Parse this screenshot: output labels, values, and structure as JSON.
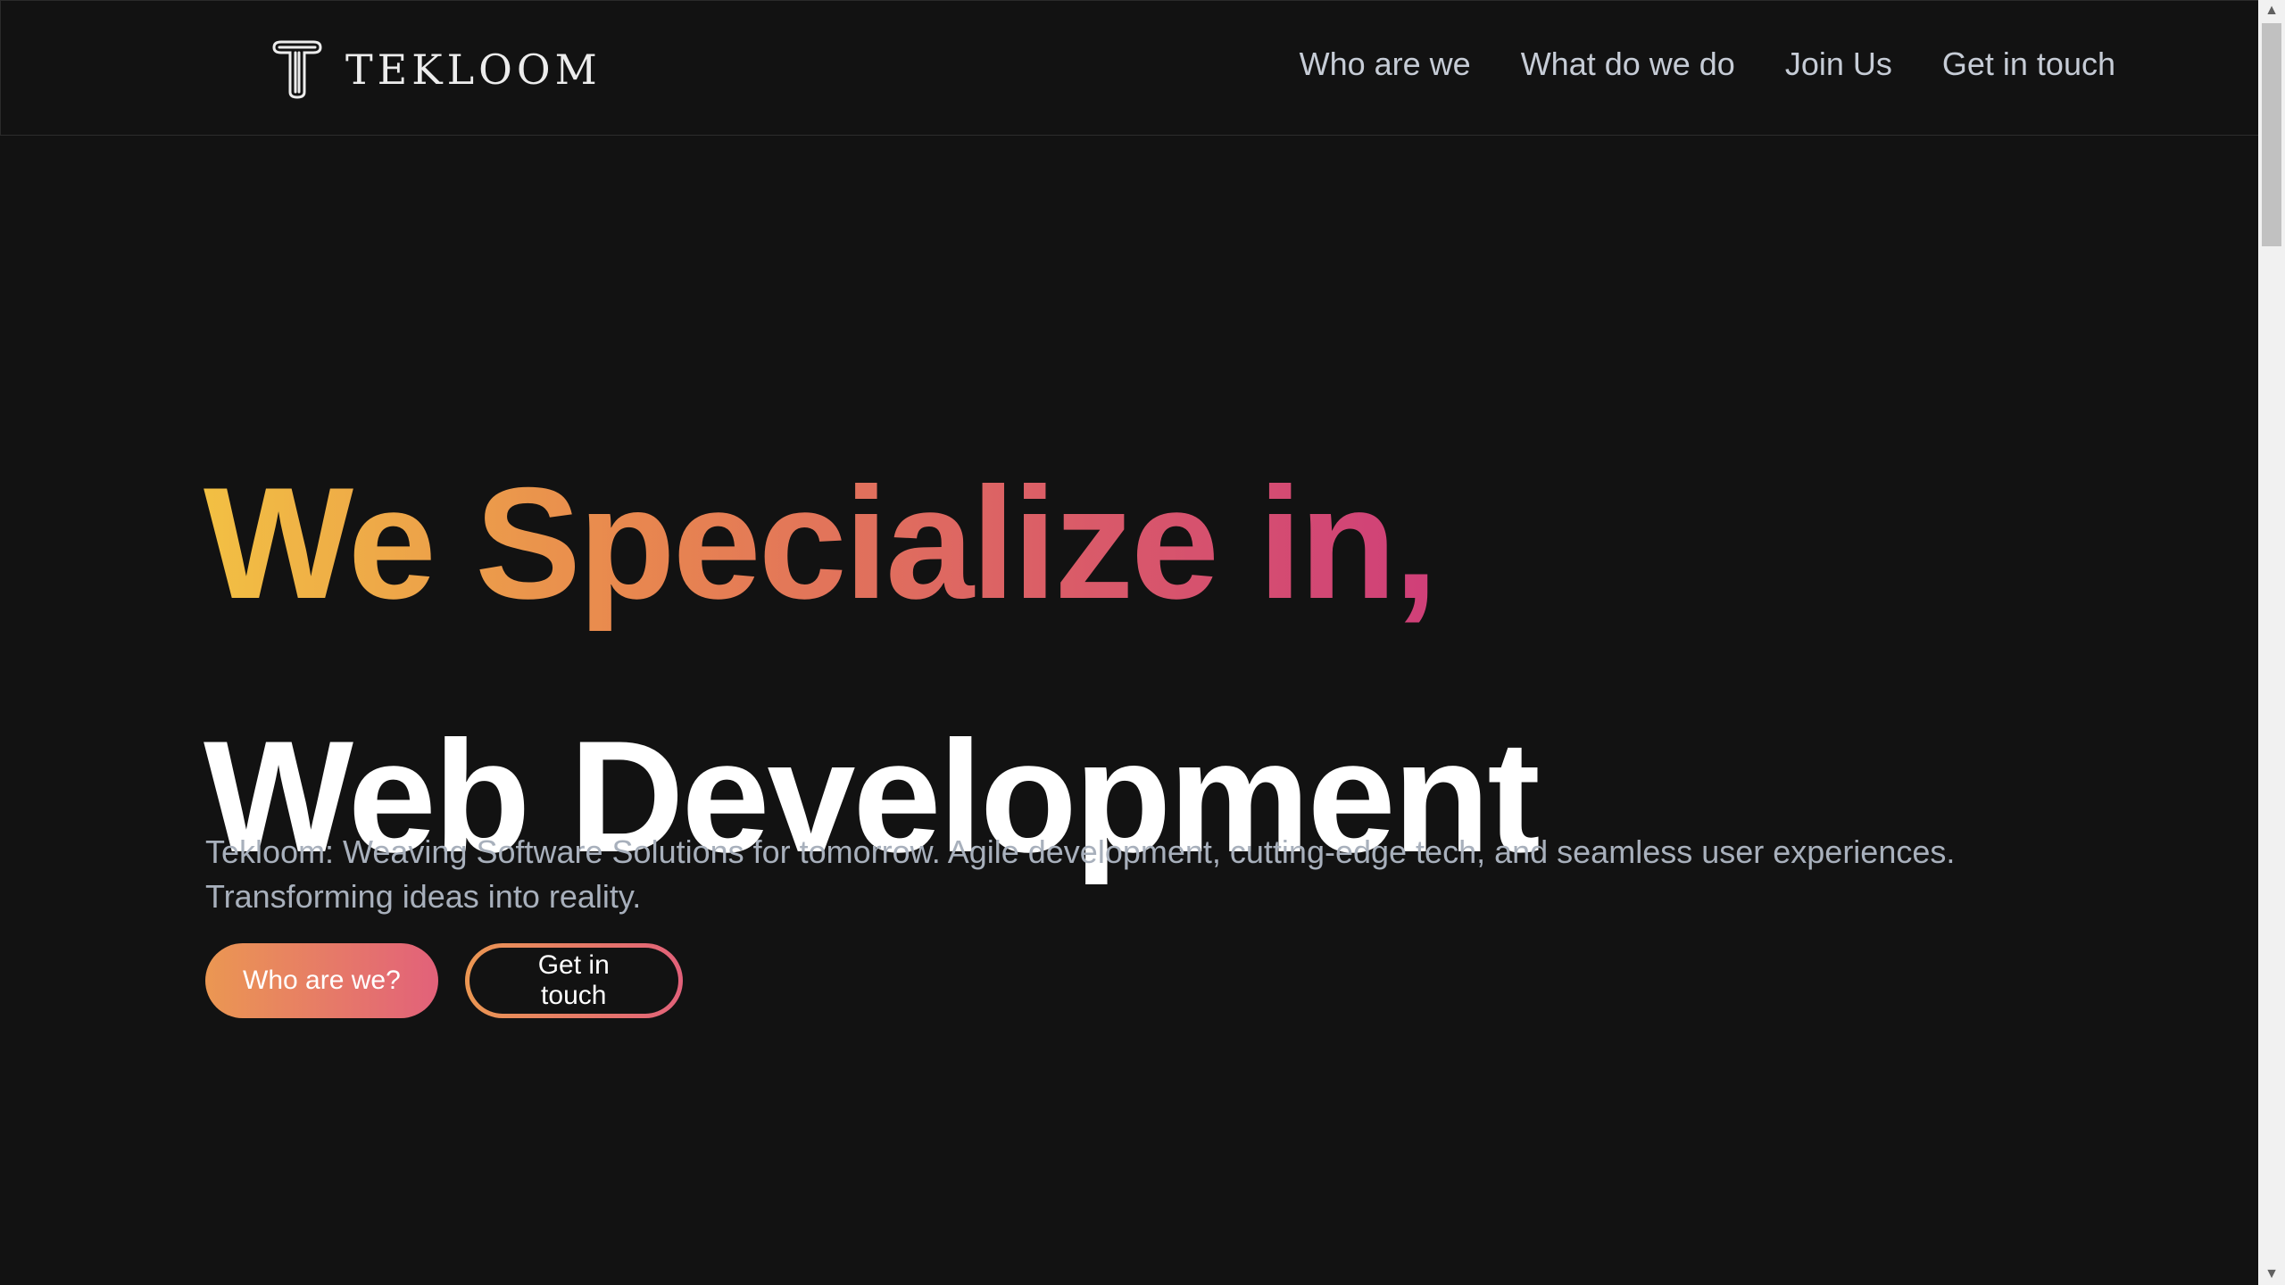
{
  "brand": {
    "name": "TEKLOOM",
    "icon": "tekloom-t-logo-icon"
  },
  "nav": {
    "items": [
      {
        "label": "Who are we"
      },
      {
        "label": "What do we do"
      },
      {
        "label": "Join Us"
      },
      {
        "label": "Get in touch"
      }
    ]
  },
  "hero": {
    "headline": "We Specialize in,",
    "specialty": "Web Development",
    "description": "Tekloom: Weaving Software Solutions for tomorrow. Agile development, cutting-edge tech, and seamless user experiences. Transforming ideas into reality.",
    "primary_button": "Who are we?",
    "secondary_button": "Get in touch"
  },
  "colors": {
    "background": "#121212",
    "gradient_start": "#f2c043",
    "gradient_mid": "#e8874f",
    "gradient_end": "#cf3f79",
    "text_primary": "#ffffff",
    "text_muted": "#a8b0bc"
  },
  "scrollbar": {
    "up_icon": "scroll-up-arrow-icon",
    "down_icon": "scroll-down-arrow-icon"
  }
}
